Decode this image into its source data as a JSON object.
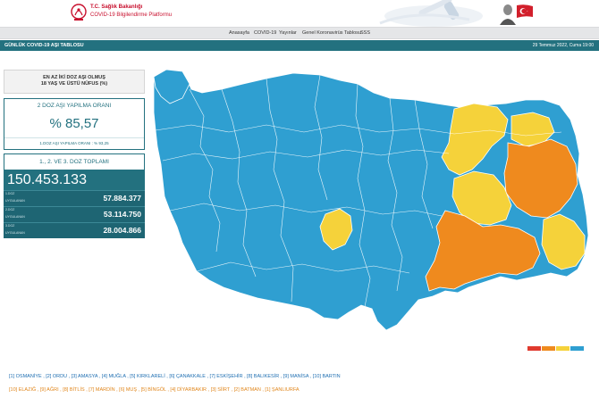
{
  "header": {
    "brand_line1": "T.C. Sağlık Bakanlığı",
    "brand_line2": "COVID-19 Bilgilendirme Platformu"
  },
  "nav": {
    "items": [
      {
        "label": "Anasayfa"
      },
      {
        "label": "COVID-19"
      },
      {
        "label": "Yayınlar"
      },
      {
        "label": "Genel Koronavirüs Tablosu"
      },
      {
        "label": "SSS"
      }
    ]
  },
  "titlebar": {
    "title": "GÜNLÜK COVID-19 AŞI TABLOSU",
    "date": "29 Temmuz 2022, Cuma 19:00"
  },
  "panel": {
    "head_line1": "EN AZ İKİ DOZ AŞI OLMUŞ",
    "head_line2": "18 YAŞ VE ÜSTÜ NÜFUS (%)",
    "dose2_label": "2 DOZ AŞI YAPILMA ORANI",
    "dose2_value": "% 85,57",
    "dose1_text": "1.DOZ AŞI YAPILMA ORANI : % 93,25",
    "total_label": "1., 2. VE 3. DOZ TOPLAMI",
    "total_value": "150.453.133",
    "doses": [
      {
        "label": "1.DOZ",
        "sub": "UYGULANAN",
        "value": "57.884.377"
      },
      {
        "label": "2.DOZ",
        "sub": "UYGULANAN",
        "value": "53.114.750"
      },
      {
        "label": "3.DOZ",
        "sub": "UYGULANAN",
        "value": "28.004.866"
      }
    ]
  },
  "map": {
    "colors": {
      "high": "#2f9fd1",
      "mid": "#f5d23a",
      "low": "#ef8a1e",
      "lowest": "#e03a2e",
      "border": "#ffffff"
    }
  },
  "footer": {
    "top_ranking": "[1] OSMANİYE , [2] ORDU , [3] AMASYA , [4] MUĞLA , [5] KIRKLARELİ , [6] ÇANAKKALE , [7] ESKİŞEHİR , [8] BALIKESİR , [9] MANİSA , [10] BARTIN",
    "bottom_ranking": "[10] ELAZIĞ , [9] AĞRI , [8] BİTLİS , [7] MARDİN , [6] MUŞ , [5] BİNGÖL , [4] DİYARBAKIR , [3] SİİRT , [2] BATMAN , [1] ŞANLIURFA"
  }
}
